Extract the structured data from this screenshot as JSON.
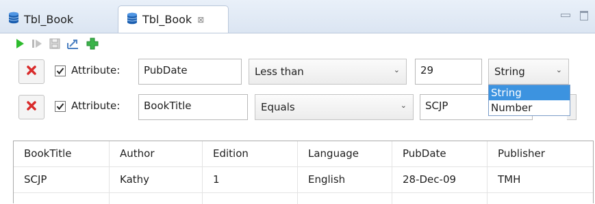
{
  "tabs": [
    {
      "label": "Tbl_Book",
      "active": false
    },
    {
      "label": "Tbl_Book",
      "active": true,
      "close_glyph": "⊠"
    }
  ],
  "toolbar": {
    "icons": [
      "run-icon",
      "run-step-icon",
      "save-icon",
      "export-icon",
      "add-filter-icon"
    ]
  },
  "filters": [
    {
      "enabled": true,
      "attribute_label": "Attribute:",
      "attribute_value": "PubDate",
      "operator": "Less than",
      "value": "29",
      "type": "String"
    },
    {
      "enabled": true,
      "attribute_label": "Attribute:",
      "attribute_value": "BookTitle",
      "operator": "Equals",
      "value": "SCJP"
    }
  ],
  "type_dropdown": {
    "options": [
      "String",
      "Number"
    ],
    "selected": "String"
  },
  "table": {
    "columns": [
      "BookTitle",
      "Author",
      "Edition",
      "Language",
      "PubDate",
      "Publisher"
    ],
    "rows": [
      [
        "SCJP",
        "Kathy",
        "1",
        "English",
        "28-Dec-09",
        "TMH"
      ]
    ]
  },
  "colors": {
    "tab_bar": "#dbe5f2",
    "selection": "#3c93e0",
    "run_green": "#2dbb2d",
    "delete_red": "#d92b2b"
  }
}
